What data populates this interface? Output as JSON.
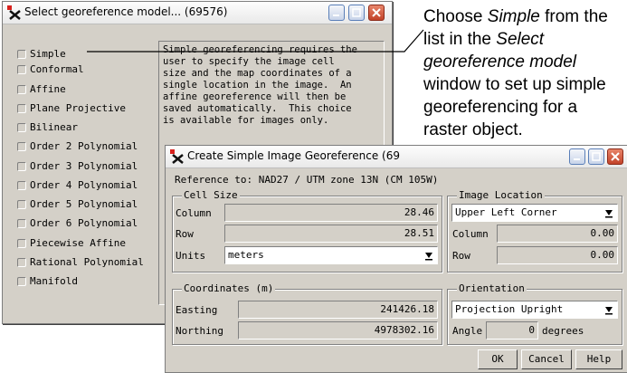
{
  "model_window": {
    "title": "Select georeference model... (69576)",
    "options": [
      {
        "label": "Simple"
      },
      {
        "label": "Conformal"
      },
      {
        "label": "Affine"
      },
      {
        "label": "Plane Projective"
      },
      {
        "label": "Bilinear"
      },
      {
        "label": "Order 2 Polynomial"
      },
      {
        "label": "Order 3 Polynomial"
      },
      {
        "label": "Order 4 Polynomial"
      },
      {
        "label": "Order 5 Polynomial"
      },
      {
        "label": "Order 6 Polynomial"
      },
      {
        "label": "Piecewise Affine"
      },
      {
        "label": "Rational Polynomial"
      },
      {
        "label": "Manifold"
      }
    ],
    "description": "Simple georeferencing requires the\nuser to specify the image cell\nsize and the map coordinates of a\nsingle location in the image.  An\naffine georeference will then be\nsaved automatically.  This choice\nis available for images only."
  },
  "simple_window": {
    "title": "Create Simple Image Georeference (69",
    "reference": "Reference to:  NAD27 / UTM zone 13N (CM 105W)",
    "cell_size": {
      "title": "Cell Size",
      "column_label": "Column",
      "column_value": "28.46",
      "row_label": "Row",
      "row_value": "28.51",
      "units_label": "Units",
      "units_value": "meters"
    },
    "image_location": {
      "title": "Image Location",
      "position_value": "Upper Left Corner",
      "column_label": "Column",
      "column_value": "0.00",
      "row_label": "Row",
      "row_value": "0.00"
    },
    "coordinates": {
      "title": "Coordinates (m)",
      "easting_label": "Easting",
      "easting_value": "241426.18",
      "northing_label": "Northing",
      "northing_value": "4978302.16"
    },
    "orientation": {
      "title": "Orientation",
      "value": "Projection Upright",
      "angle_label": "Angle",
      "angle_value": "0",
      "degrees_label": "degrees"
    },
    "buttons": {
      "ok": "OK",
      "cancel": "Cancel",
      "help": "Help"
    }
  },
  "callout": {
    "t1": "Choose ",
    "t2": "Simple",
    "t3": " from the list in the ",
    "t4": "Select georeference model",
    "t5": " window to set up simple georeferencing for a raster object."
  },
  "colors": {
    "dialog_bg": "#d4d0c8",
    "close_button": "#c2432a"
  }
}
